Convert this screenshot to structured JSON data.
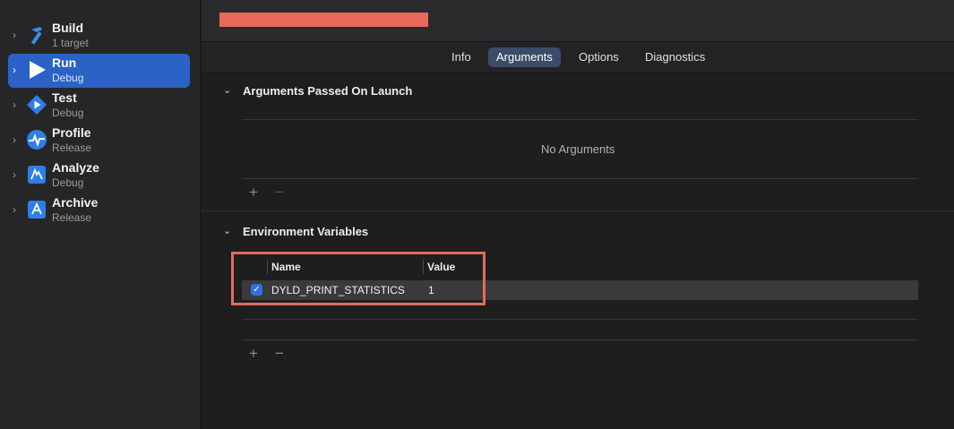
{
  "sidebar": {
    "items": [
      {
        "title": "Build",
        "subtitle": "1 target",
        "icon": "hammer-icon",
        "selected": false
      },
      {
        "title": "Run",
        "subtitle": "Debug",
        "icon": "play-icon",
        "selected": true
      },
      {
        "title": "Test",
        "subtitle": "Debug",
        "icon": "diamond-play-icon",
        "selected": false
      },
      {
        "title": "Profile",
        "subtitle": "Release",
        "icon": "gauge-icon",
        "selected": false
      },
      {
        "title": "Analyze",
        "subtitle": "Debug",
        "icon": "analyze-icon",
        "selected": false
      },
      {
        "title": "Archive",
        "subtitle": "Release",
        "icon": "archive-icon",
        "selected": false
      }
    ]
  },
  "tabs": [
    {
      "label": "Info",
      "active": false
    },
    {
      "label": "Arguments",
      "active": true
    },
    {
      "label": "Options",
      "active": false
    },
    {
      "label": "Diagnostics",
      "active": false
    }
  ],
  "arguments_section": {
    "title": "Arguments Passed On Launch",
    "empty_text": "No Arguments",
    "add_symbol": "+",
    "remove_symbol": "−"
  },
  "env_section": {
    "title": "Environment Variables",
    "columns": {
      "name": "Name",
      "value": "Value"
    },
    "rows": [
      {
        "checked": true,
        "name": "DYLD_PRINT_STATISTICS",
        "value": "1"
      }
    ],
    "add_symbol": "+",
    "remove_symbol": "−"
  },
  "colors": {
    "accent": "#2a62c6",
    "highlight_box": "#e46a5c",
    "redaction": "#e9685a"
  }
}
